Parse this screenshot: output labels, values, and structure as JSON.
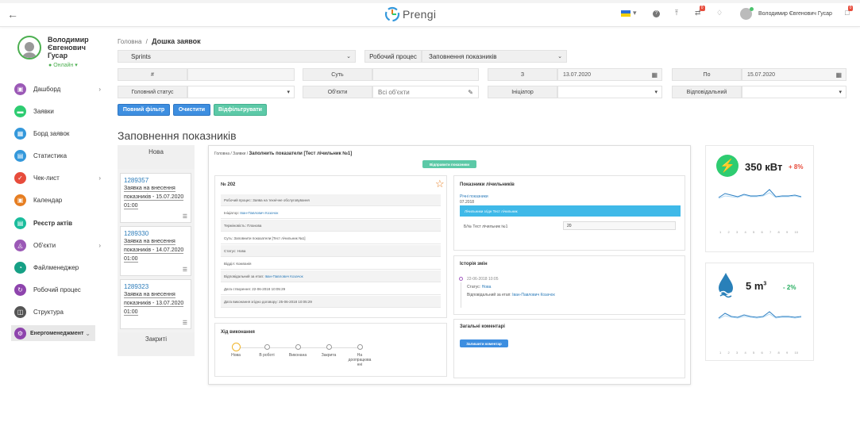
{
  "header": {
    "logo_text": "Prengi",
    "user_name": "Володимир Євгенович Гусар",
    "badge_tasks": "0",
    "badge_messages": "0"
  },
  "sidebar": {
    "name_line1": "Володимир",
    "name_line2": "Євгенович",
    "name_line3": "Гусар",
    "status": "Онлайн",
    "items": [
      {
        "label": "Дашборд",
        "color": "#9b59b6",
        "icon": "dashboard-icon"
      },
      {
        "label": "Заявки",
        "color": "#2ecc71",
        "icon": "requests-icon"
      },
      {
        "label": "Борд заявок",
        "color": "#3498db",
        "icon": "board-icon"
      },
      {
        "label": "Статистика",
        "color": "#3498db",
        "icon": "stats-icon"
      },
      {
        "label": "Чек-лист",
        "color": "#e74c3c",
        "icon": "checklist-icon"
      },
      {
        "label": "Календар",
        "color": "#e67e22",
        "icon": "calendar-icon"
      },
      {
        "label": "Реєстр актів",
        "color": "#1abc9c",
        "icon": "registry-icon"
      },
      {
        "label": "Об'єкти",
        "color": "#9b59b6",
        "icon": "objects-icon"
      },
      {
        "label": "Файлменеджер",
        "color": "#16a085",
        "icon": "files-icon"
      },
      {
        "label": "Робочий процес",
        "color": "#8e44ad",
        "icon": "workflow-icon"
      },
      {
        "label": "Структура",
        "color": "#555555",
        "icon": "structure-icon"
      },
      {
        "label": "Енергоменеджмент",
        "color": "#8e44ad",
        "icon": "energy-icon"
      }
    ]
  },
  "breadcrumb": {
    "home": "Головна",
    "separator": "/",
    "current": "Дошка заявок"
  },
  "filters": {
    "sprints_label": "Sprints",
    "workflow_label": "Робочий процес",
    "workflow_value": "Заповнення показників",
    "number_label": "#",
    "essence_label": "Суть",
    "from_label": "З",
    "from_value": "13.07.2020",
    "to_label": "По",
    "to_value": "15.07.2020",
    "status_label": "Головний статус",
    "objects_label": "Об'єкти",
    "objects_placeholder": "Всі об'єкти",
    "initiator_label": "Ініціатор",
    "responsible_label": "Відповідальний"
  },
  "buttons": {
    "full_filter": "Повний фільтр",
    "clear": "Очистити",
    "apply": "Відфільтрувати"
  },
  "page_title": "Заповнення показників",
  "column": {
    "header": "Нова",
    "footer": "Закриті",
    "cards": [
      {
        "id": "1289357",
        "line1": "Заявка на внесення",
        "line2": "показників - 15.07.2020",
        "line3": "01:00"
      },
      {
        "id": "1289330",
        "line1": "Заявка на внесення",
        "line2": "показників - 14.07.2020",
        "line3": "01:00"
      },
      {
        "id": "1289323",
        "line1": "Заявка на внесення",
        "line2": "показників - 13.07.2020",
        "line3": "01:00"
      }
    ]
  },
  "preview": {
    "breadcrumb_home": "Головна",
    "breadcrumb_req": "Заявки",
    "breadcrumb_title": "Заполнить показатели [Тест лічильник №1]",
    "send_button": "Відправити показники",
    "ticket_no": "№ 202",
    "rows": [
      {
        "label": "Робочий процес:",
        "value": "Заява на технічне обслуговування",
        "link": false
      },
      {
        "label": "Ініціатор:",
        "value": "Іван-Павлович Козачок",
        "link": true
      },
      {
        "label": "Терміновість:",
        "value": "Планова",
        "link": false
      },
      {
        "label": "Суть:",
        "value": "Заповнити показатели [Тест лічильник №1]",
        "link": false
      },
      {
        "label": "Статус:",
        "value": "Нова",
        "link": false
      },
      {
        "label": "Відділ:",
        "value": "Компанія",
        "link": false
      },
      {
        "label": "Відповідальний за етап:",
        "value": "Іван-Павлович Козачок",
        "link": true
      },
      {
        "label": "Дата створення:",
        "value": "22-06-2018 10:05:29",
        "link": false
      },
      {
        "label": "Дата виконання згідно договору:",
        "value": "25-06-2018 10:05:29",
        "link": false
      }
    ],
    "progress_title": "Хід виконання",
    "progress_steps": [
      "Нова",
      "В роботі",
      "Виконана",
      "Закрита",
      "На доопрацюва нні"
    ],
    "meters_title": "Показники лічильників",
    "meters_link": "Річні показники",
    "meters_date": "07.2018",
    "meters_bar": "Лічильники згідн Тест лічильник",
    "meter_name": "Б/№ Тест лічильник №1",
    "meter_value": "20",
    "history_title": "Історія змін",
    "history_date": "22-06-2018 10:05",
    "history_status_label": "Статус:",
    "history_status": "Нова",
    "history_resp_label": "Відповідальний за етап:",
    "history_resp": "Іван-Павлович Козачок",
    "comments_title": "Загальні коментарі",
    "comment_button": "Залишити коментар"
  },
  "widgets": [
    {
      "value": "350 кВт",
      "change": "+ 8%",
      "change_color": "#e74c3c",
      "icon": "lightning-icon",
      "icon_color": "#2ecc71",
      "ticks": [
        "1",
        "2",
        "3",
        "4",
        "5",
        "6",
        "7",
        "8",
        "9",
        "10"
      ]
    },
    {
      "value": "5 m",
      "sup": "3",
      "change": "- 2%",
      "change_color": "#27ae60",
      "icon": "water-drop-icon",
      "icon_color": "#2980b9",
      "ticks": [
        "1",
        "2",
        "3",
        "4",
        "5",
        "6",
        "7",
        "8",
        "9",
        "10"
      ]
    }
  ]
}
